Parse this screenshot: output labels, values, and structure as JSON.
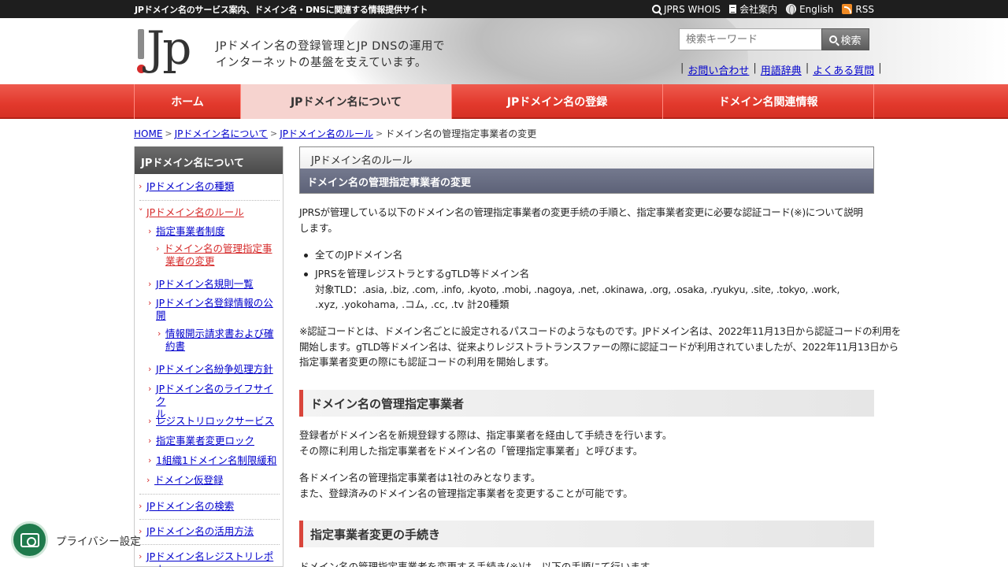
{
  "topbar": {
    "tagline": "JPドメイン名のサービス案内、ドメイン名・DNSに関連する情報提供サイト",
    "links": [
      {
        "icon": "search-icon",
        "label": "JPRS WHOIS"
      },
      {
        "icon": "document-icon",
        "label": "会社案内"
      },
      {
        "icon": "globe-icon",
        "label": "English"
      },
      {
        "icon": "rss-icon",
        "label": "RSS"
      }
    ]
  },
  "header": {
    "logo_text": "Jp",
    "catch_line1": "JPドメイン名の登録管理とJP DNSの運用で",
    "catch_line2": "インターネットの基盤を支えています。",
    "search_placeholder": "検索キーワード",
    "search_button": "検索",
    "help_links": [
      "お問い合わせ",
      "用語辞典",
      "よくある質問"
    ],
    "help_sep": "|"
  },
  "nav": {
    "items": [
      "ホーム",
      "JPドメイン名について",
      "JPドメイン名の登録",
      "ドメイン名関連情報"
    ],
    "active_index": 1
  },
  "breadcrumb": {
    "links": [
      "HOME",
      "JPドメイン名について",
      "JPドメイン名のルール"
    ],
    "current": "ドメイン名の管理指定事業者の変更",
    "sep": ">"
  },
  "sidebar": {
    "title": "JPドメイン名について",
    "items": [
      {
        "label": "JPドメイン名の種類"
      },
      {
        "label": "JPドメイン名のルール"
      },
      {
        "label": "指定事業者制度"
      },
      {
        "label_line1": "ドメイン名の管理指定事",
        "label_line2": "業者の変更"
      },
      {
        "label": "JPドメイン名規則一覧"
      },
      {
        "label_line1": "JPドメイン名登録情報の公",
        "label_line2": "開"
      },
      {
        "label_line1": "情報開示請求書および確",
        "label_line2": "約書"
      },
      {
        "label": "JPドメイン名紛争処理方針"
      },
      {
        "label_line1": "JPドメイン名のライフサイク",
        "label_line2": "ル"
      },
      {
        "label": "レジストリロックサービス"
      },
      {
        "label": "指定事業者変更ロック"
      },
      {
        "label": "1組織1ドメイン名制限緩和"
      },
      {
        "label": "ドメイン仮登録"
      },
      {
        "label": "JPドメイン名の検索"
      },
      {
        "label": "JPドメイン名の活用方法"
      },
      {
        "label": "JPドメイン名レジストリレポート"
      }
    ]
  },
  "main": {
    "subtitle": "JPドメイン名のルール",
    "title": "ドメイン名の管理指定事業者の変更",
    "intro_line1": "JPRSが管理している以下のドメイン名の管理指定事業者の変更手続の手順と、指定事業者変更に必要な認証コード(※)について説明",
    "intro_line2": "します。",
    "bullets": [
      {
        "text": "全てのJPドメイン名"
      },
      {
        "text": "JPRSを管理レジストラとするgTLD等ドメイン名",
        "sub_line1": "対象TLD：.asia, .biz, .com, .info, .kyoto, .mobi, .nagoya, .net, .okinawa, .org, .osaka, .ryukyu, .site, .tokyo, .work,",
        "sub_line2": ".xyz, .yokohama, .コム, .cc, .tv 計20種類"
      }
    ],
    "note_line1": "※認証コードとは、ドメイン名ごとに設定されるパスコードのようなものです。JPドメイン名は、2022年11月13日から認証コードの利用を",
    "note_line2": "開始します。gTLD等ドメイン名は、従来よりレジストラトランスファーの際に認証コードが利用されていましたが、2022年11月13日から",
    "note_line3": "指定事業者変更の際にも認証コードの利用を開始します。",
    "section1_title": "ドメイン名の管理指定事業者",
    "s1_p1_line1": "登録者がドメイン名を新規登録する際は、指定事業者を経由して手続きを行います。",
    "s1_p1_line2": "その際に利用した指定事業者をドメイン名の「管理指定事業者」と呼びます。",
    "s1_p2_line1": "各ドメイン名の管理指定事業者は1社のみとなります。",
    "s1_p2_line2": "また、登録済みのドメイン名の管理指定事業者を変更することが可能です。",
    "section2_title": "指定事業者変更の手続き",
    "s2_p1": "ドメイン名の管理指定事業者を変更する手続き(※)は、以下の手順にて行います。"
  },
  "privacy": {
    "label": "プライバシー設定"
  }
}
